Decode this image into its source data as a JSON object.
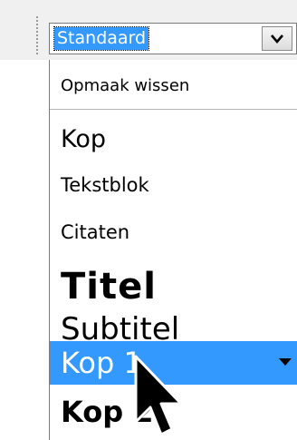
{
  "style_combo": {
    "value": "Standaard",
    "button_icon": "chevron-down-icon"
  },
  "dropdown": {
    "items": [
      {
        "label": "Opmaak wissen"
      },
      {
        "label": "Kop"
      },
      {
        "label": "Tekstblok"
      },
      {
        "label": "Citaten"
      },
      {
        "label": "Titel"
      },
      {
        "label": "Subtitel"
      },
      {
        "label": "Kop 1",
        "selected": true,
        "submenu_icon": "submenu-arrow-icon"
      },
      {
        "label": "Kop 2"
      }
    ]
  },
  "colors": {
    "selection": "#3399ff",
    "toolbar_bg": "#f0f0f0"
  },
  "cursor": {
    "icon": "mouse-pointer-icon"
  }
}
